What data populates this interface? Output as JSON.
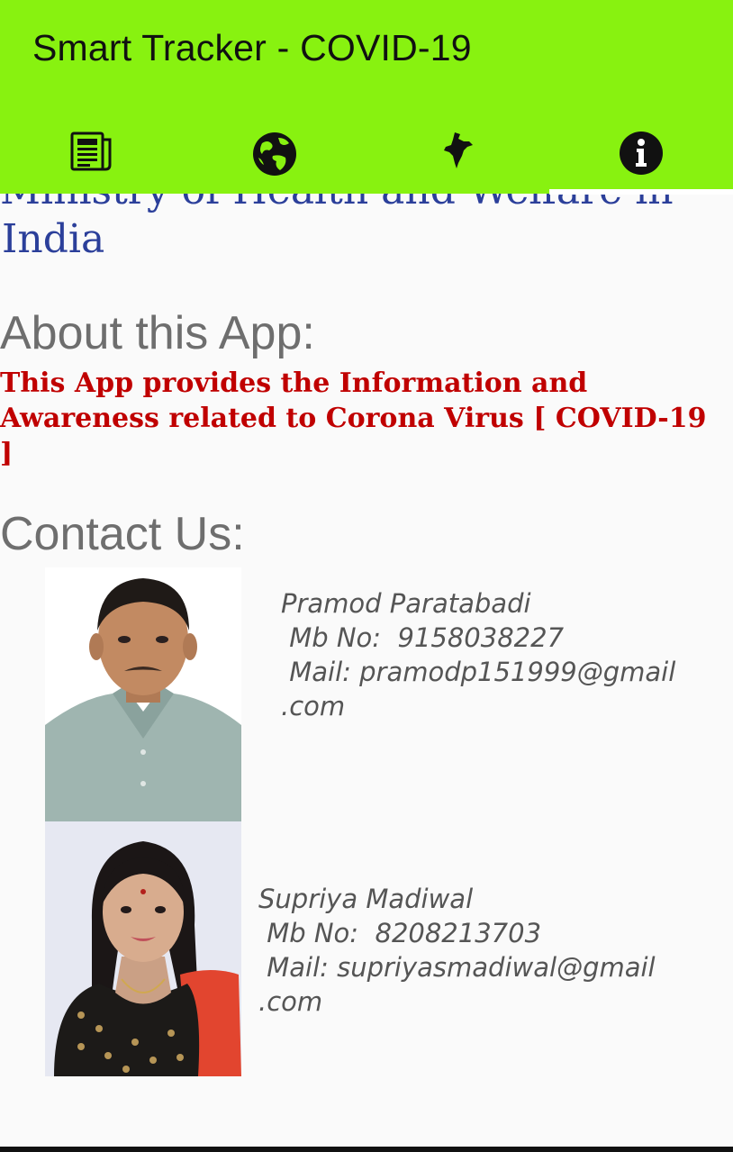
{
  "app": {
    "title": "Smart Tracker - COVID-19"
  },
  "tabs": [
    {
      "icon": "newspaper-icon",
      "label": "News"
    },
    {
      "icon": "globe-icon",
      "label": "World"
    },
    {
      "icon": "india-map-icon",
      "label": "India"
    },
    {
      "icon": "info-icon",
      "label": "Info"
    }
  ],
  "content": {
    "ministry_cut_line": "Ministry of Health and Welfare in",
    "ministry_last_line": "India",
    "about_heading": "About this App:",
    "about_text": "This App provides the Information and Awareness related to Corona Virus [ COVID-19 ]",
    "contact_heading": "Contact Us:"
  },
  "contacts": [
    {
      "name": "Pramod Paratabadi",
      "mobile": " Mb No:  9158038227",
      "mail": " Mail: pramodp151999@gmail",
      "mail_tail": ".com"
    },
    {
      "name": "Supriya Madiwal",
      "mobile": " Mb No:  8208213703",
      "mail": " Mail: supriyasmadiwal@gmail",
      "mail_tail": ".com"
    }
  ],
  "colors": {
    "app_bar": "#88f210",
    "ministry_text": "#2b3f9a",
    "about_text": "#c00000",
    "heading_text": "#6e6e6e"
  }
}
